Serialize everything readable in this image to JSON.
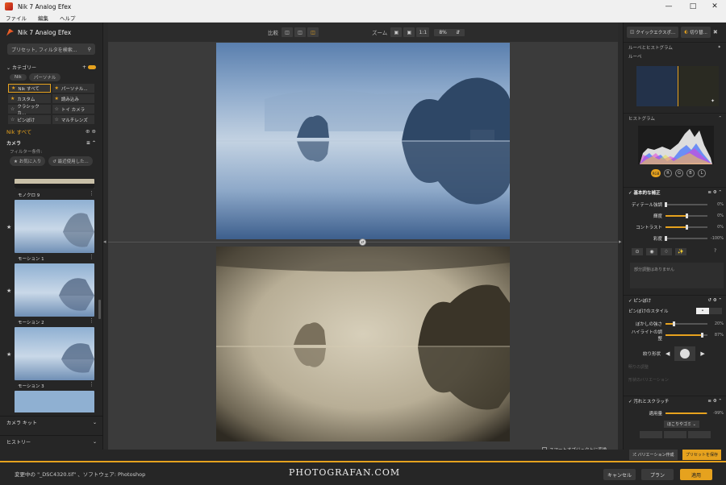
{
  "window": {
    "title": "Nik 7 Analog Efex"
  },
  "menu": [
    "ファイル",
    "編集",
    "ヘルプ"
  ],
  "left": {
    "app_title": "Nik 7 Analog Efex",
    "search_placeholder": "プリセット, フィルタを検索...",
    "category_label": "カテゴリー",
    "chips": [
      "Nik",
      "パーソナル"
    ],
    "categories": [
      {
        "label": "Nik すべて",
        "star": true,
        "selected": true
      },
      {
        "label": "パーソナル...",
        "star": true
      },
      {
        "label": "カスタム",
        "star": true
      },
      {
        "label": "読み込み",
        "star": true
      },
      {
        "label": "クラシック カ...",
        "star": false
      },
      {
        "label": "トイ カメラ",
        "star": false
      },
      {
        "label": "ピンぼけ",
        "star": false
      },
      {
        "label": "マルチレンズ",
        "star": false
      }
    ],
    "nik_all": "Nik すべて",
    "camera_label": "カメラ",
    "filter_cond": "フィルター条件:",
    "filter_buttons": [
      "お気に入り",
      "最近使用した..."
    ],
    "thumbs": [
      {
        "label": "モノクロ 9"
      },
      {
        "label": "モーション 1"
      },
      {
        "label": "モーション 2"
      },
      {
        "label": "モーション 3"
      }
    ],
    "camera_kit": "カメラ キット",
    "history": "ヒストリー"
  },
  "toolbar": {
    "compare": "比較",
    "zoom": "ズーム",
    "zoom_1to1": "1:1",
    "zoom_value": "8%"
  },
  "smart_object": "スマートオブジェクトに変換",
  "right": {
    "quick_export": "クイックエクスポ...",
    "crop": "切り替...",
    "loupe_hist": "ルーペとヒストグラム",
    "loupe": "ルーペ",
    "histogram": "ヒストグラム",
    "channels": [
      "RGB",
      "R",
      "G",
      "B",
      "L"
    ],
    "basic": "基本的な補正",
    "basic_sliders": [
      {
        "label": "ディテール強調",
        "value": "0%",
        "level": 0.0
      },
      {
        "label": "輝度",
        "value": "0%",
        "level": 0.5
      },
      {
        "label": "コントラスト",
        "value": "0%",
        "level": 0.5
      },
      {
        "label": "彩度",
        "value": "-100%",
        "level": 0.0
      }
    ],
    "no_local": "部分調整はありません",
    "blur": "ピンぼけ",
    "blur_style": "ピンぼけのスタイル",
    "blur_sliders": [
      {
        "label": "ぼかしの強さ",
        "value": "20%",
        "level": 0.2
      },
      {
        "label": "ハイライトの調整",
        "value": "87%",
        "level": 0.87
      }
    ],
    "aperture_shape": "絞り形状",
    "disabled_sliders": [
      "明りの調整",
      "形状のバリエーション"
    ],
    "dust": "汚れとスクラッチ",
    "amount": "適用量",
    "amount_value": "-99%",
    "amount_level": 0.99,
    "dust_select": "ほこりやゴミ",
    "make_variation": "バリエーション作成",
    "save_preset": "プリセットを保存"
  },
  "footer": {
    "status": "変更中の \"_DSC4320.tif\" 、ソフトウェア: Photoshop",
    "watermark": "PHOTOGRAFAN.COM",
    "cancel": "キャンセル",
    "plan": "プラン",
    "apply": "適用"
  },
  "colors": {
    "accent": "#e6a21e",
    "panel": "#262626",
    "canvas": "#3b3b3b"
  }
}
